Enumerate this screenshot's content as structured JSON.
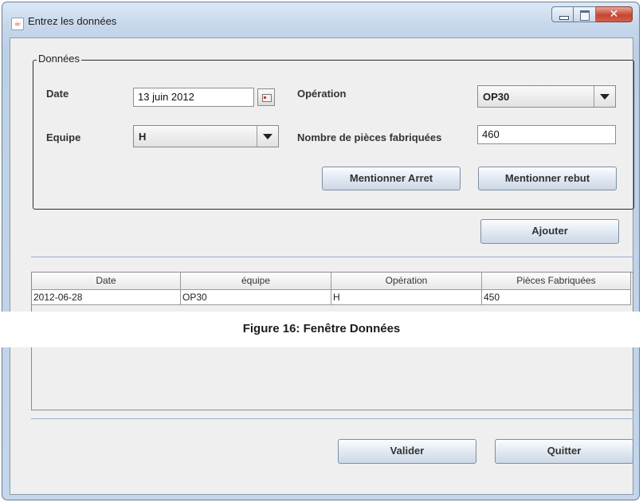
{
  "window": {
    "title": "Entrez les données",
    "app_icon": "java-cup-icon",
    "controls": {
      "minimize": "minimize-icon",
      "maximize": "maximize-icon",
      "close": "✕"
    }
  },
  "group": {
    "legend": "Données",
    "date_label": "Date",
    "date_value": "13 juin 2012",
    "operation_label": "Opération",
    "operation_value": "OP30",
    "equipe_label": "Equipe",
    "equipe_value": "H",
    "pieces_label": "Nombre de pièces fabriquées",
    "pieces_value": "460",
    "arret_button": "Mentionner Arret",
    "rebut_button": "Mentionner rebut"
  },
  "ajouter_button": "Ajouter",
  "table": {
    "columns": [
      "Date",
      "équipe",
      "Opération",
      "Pièces Fabriquées"
    ],
    "rows": [
      [
        "2012-06-28",
        "OP30",
        "H",
        "450"
      ]
    ]
  },
  "caption": "Figure 16: Fenêtre Données",
  "footer": {
    "valider_button": "Valider",
    "quitter_button": "Quitter"
  }
}
